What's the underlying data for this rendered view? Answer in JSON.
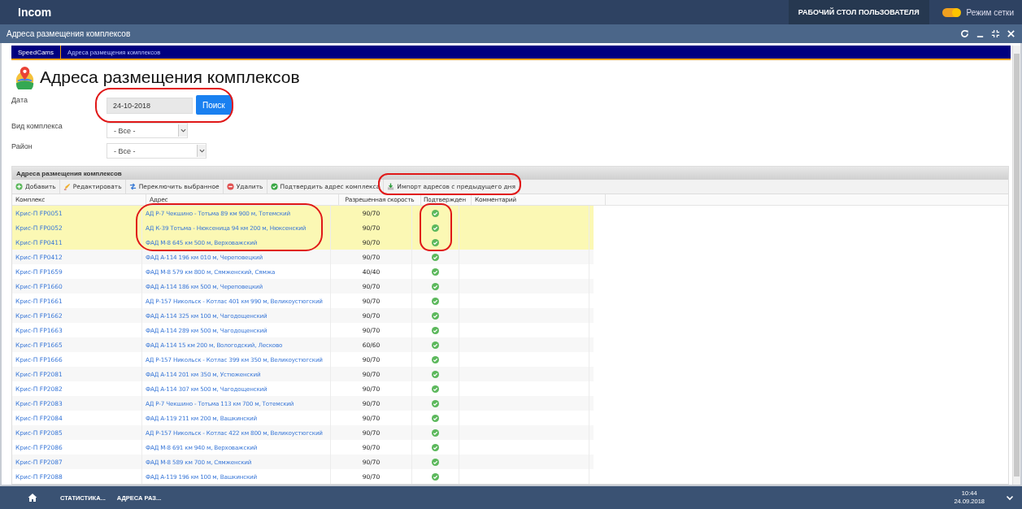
{
  "app_bar": {
    "logo": "Incom",
    "desktop_button": "РАБОЧИЙ СТОЛ ПОЛЬЗОВАТЕЛЯ",
    "grid_mode": {
      "label": "Режим сетки",
      "on": true
    }
  },
  "window": {
    "title": "Адреса размещения комплексов"
  },
  "breadcrumbs": [
    {
      "label": "SpeedCams",
      "selected": true
    },
    {
      "label": "Адреса размещения комплексов",
      "selected": false
    }
  ],
  "page_title": "Адреса размещения комплексов",
  "filters": [
    {
      "kind": "date",
      "label": "Дата",
      "value": "24-10-2018",
      "button": "Поиск"
    },
    {
      "kind": "select",
      "label": "Вид комплекса",
      "value": "- Все -"
    },
    {
      "kind": "select",
      "label": "Район",
      "value": "- Все -"
    }
  ],
  "grid": {
    "title": "Адреса размещения комплексов",
    "toolbar": [
      {
        "label": "Добавить",
        "kind": "add"
      },
      {
        "label": "Редактировать",
        "kind": "edit"
      },
      {
        "label": "Переключить выбранное",
        "kind": "toggle"
      },
      {
        "label": "Удалить",
        "kind": "delete"
      },
      {
        "label": "Подтвердить адрес комплекса",
        "kind": "confirm"
      },
      {
        "label": "Импорт адресов с предыдущего дня",
        "kind": "import"
      }
    ],
    "columns": [
      "Комплекс",
      "Адрес",
      "Разрешенная скорость",
      "Подтвержден",
      "Комментарий"
    ],
    "rows": [
      {
        "complex": "Крис-П FP0051",
        "address": "АД Р-7 Чекшино - Тотьма 89 км 900 м, Тотемский",
        "speed": "90/70",
        "confirmed": true,
        "selected": true
      },
      {
        "complex": "Крис-П FP0052",
        "address": "АД К-39 Тотьма - Нюксеница 94 км 200 м, Нюксенский",
        "speed": "90/70",
        "confirmed": true,
        "selected": true
      },
      {
        "complex": "Крис-П FP0411",
        "address": "ФАД М-8 645 км 500 м, Верховажский",
        "speed": "90/70",
        "confirmed": true,
        "selected": true
      },
      {
        "complex": "Крис-П FP0412",
        "address": "ФАД А-114 196 км 010 м, Череповецкий",
        "speed": "90/70",
        "confirmed": true,
        "selected": false
      },
      {
        "complex": "Крис-П FP1659",
        "address": "ФАД М-8 579 км 800 м, Сямженский, Сямжа",
        "speed": "40/40",
        "confirmed": true,
        "selected": false
      },
      {
        "complex": "Крис-П FP1660",
        "address": "ФАД А-114 186 км 500 м, Череповецкий",
        "speed": "90/70",
        "confirmed": true,
        "selected": false
      },
      {
        "complex": "Крис-П FP1661",
        "address": "АД Р-157 Никольск - Котлас 401 км 990 м, Великоустюгский",
        "speed": "90/70",
        "confirmed": true,
        "selected": false
      },
      {
        "complex": "Крис-П FP1662",
        "address": "ФАД А-114 325 км 100 м, Чагодощенский",
        "speed": "90/70",
        "confirmed": true,
        "selected": false
      },
      {
        "complex": "Крис-П FP1663",
        "address": "ФАД А-114 289 км 500 м, Чагодощенский",
        "speed": "90/70",
        "confirmed": true,
        "selected": false
      },
      {
        "complex": "Крис-П FP1665",
        "address": "ФАД А-114 15 км 200 м, Вологодский, Лесково",
        "speed": "60/60",
        "confirmed": true,
        "selected": false
      },
      {
        "complex": "Крис-П FP1666",
        "address": "АД Р-157 Никольск - Котлас 399 км 350 м, Великоустюгский",
        "speed": "90/70",
        "confirmed": true,
        "selected": false
      },
      {
        "complex": "Крис-П FP2081",
        "address": "ФАД А-114 201 км 350 м, Устюженский",
        "speed": "90/70",
        "confirmed": true,
        "selected": false
      },
      {
        "complex": "Крис-П FP2082",
        "address": "ФАД А-114 307 км 500 м, Чагодощенский",
        "speed": "90/70",
        "confirmed": true,
        "selected": false
      },
      {
        "complex": "Крис-П FP2083",
        "address": "АД Р-7 Чекшино - Тотьма 113 км 700 м, Тотемский",
        "speed": "90/70",
        "confirmed": true,
        "selected": false
      },
      {
        "complex": "Крис-П FP2084",
        "address": "ФАД А-119 211 км 200 м, Вашкинский",
        "speed": "90/70",
        "confirmed": true,
        "selected": false
      },
      {
        "complex": "Крис-П FP2085",
        "address": "АД Р-157 Никольск - Котлас 422 км 800 м, Великоустюгский",
        "speed": "90/70",
        "confirmed": true,
        "selected": false
      },
      {
        "complex": "Крис-П FP2086",
        "address": "ФАД М-8 691 км 940 м, Верховажский",
        "speed": "90/70",
        "confirmed": true,
        "selected": false
      },
      {
        "complex": "Крис-П FP2087",
        "address": "ФАД М-8 589 км 700 м, Сямженский",
        "speed": "90/70",
        "confirmed": true,
        "selected": false
      },
      {
        "complex": "Крис-П FP2088",
        "address": "ФАД А-119 196 км 100 м, Вашкинский",
        "speed": "90/70",
        "confirmed": true,
        "selected": false
      }
    ]
  },
  "taskbar": {
    "items": [
      "СТАТИСТИКА...",
      "АДРЕСА РАЗ..."
    ],
    "time": "10:44",
    "date": "24.09.2018"
  }
}
